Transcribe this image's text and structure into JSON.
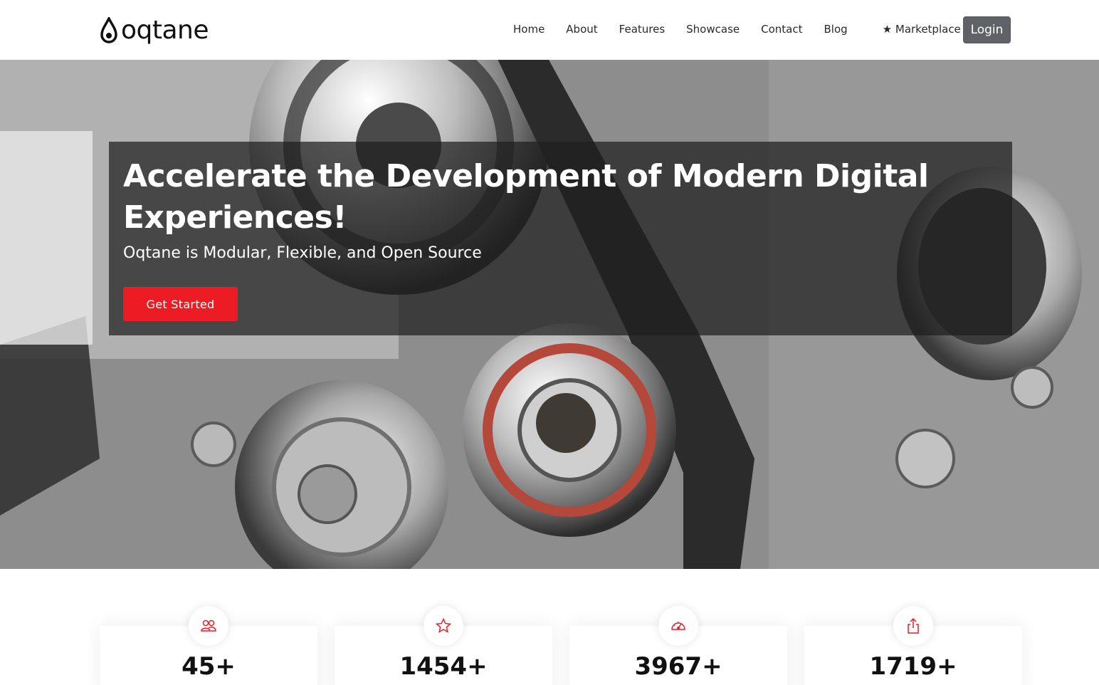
{
  "brand": {
    "name": "oqtane"
  },
  "nav": {
    "items": [
      {
        "label": "Home"
      },
      {
        "label": "About"
      },
      {
        "label": "Features"
      },
      {
        "label": "Showcase"
      },
      {
        "label": "Contact"
      },
      {
        "label": "Blog"
      }
    ],
    "marketplace_label": "★ Marketplace ★",
    "login_label": "Login"
  },
  "hero": {
    "title": "Accelerate the Development of Modern Digital Experiences!",
    "subtitle": "Oqtane is Modular, Flexible, and Open Source",
    "cta_label": "Get Started"
  },
  "stats": [
    {
      "icon": "people-icon",
      "value": "45+"
    },
    {
      "icon": "star-icon",
      "value": "1454+"
    },
    {
      "icon": "speedometer-icon",
      "value": "3967+"
    },
    {
      "icon": "share-icon",
      "value": "1719+"
    }
  ],
  "colors": {
    "accent": "#ec1c24",
    "login_bg": "#5f6368",
    "overlay": "rgba(30,30,30,0.72)"
  }
}
